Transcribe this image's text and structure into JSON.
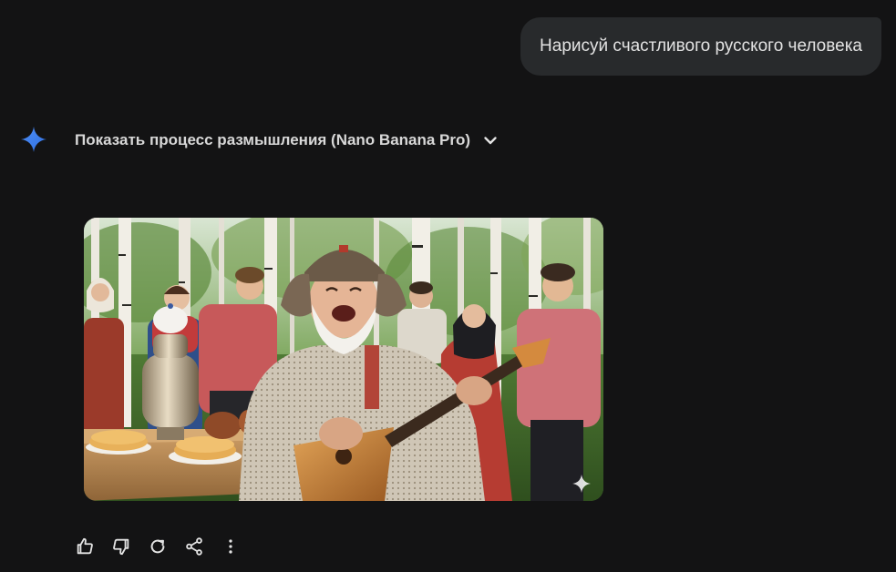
{
  "user_message": {
    "text": "Нарисуй счастливого русского человека"
  },
  "response": {
    "icon": "gemini-spark-icon",
    "thinking_toggle_label": "Показать процесс размышления (Nano Banana Pro)",
    "toggle_icon": "chevron-down-icon",
    "image": {
      "subject": "image"
    },
    "actions": [
      {
        "name": "like-button",
        "icon": "thumbs-up-icon"
      },
      {
        "name": "dislike-button",
        "icon": "thumbs-down-icon"
      },
      {
        "name": "regenerate-button",
        "icon": "refresh-icon"
      },
      {
        "name": "share-button",
        "icon": "share-icon"
      },
      {
        "name": "more-options-button",
        "icon": "more-vert-icon"
      }
    ]
  },
  "colors": {
    "background": "#131314",
    "bubble": "#282a2c",
    "text": "#e3e3e3",
    "accent": "#4b8cf5"
  }
}
